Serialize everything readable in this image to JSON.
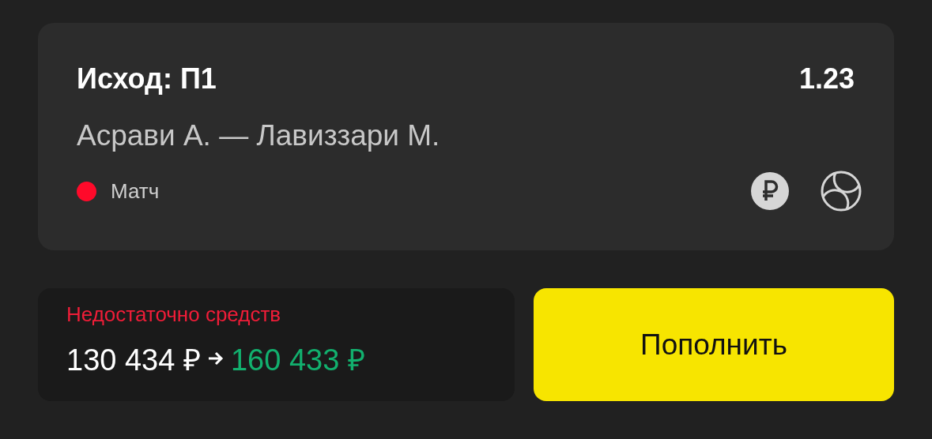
{
  "bet": {
    "outcome": "Исход: П1",
    "odds": "1.23",
    "event": "Асрави А. — Лавиззари М.",
    "live": true,
    "status": "Матч"
  },
  "balance": {
    "warning": "Недостаточно средств",
    "current": "130 434 ₽",
    "required": "160 433 ₽"
  },
  "button": {
    "label": "Пополнить"
  }
}
